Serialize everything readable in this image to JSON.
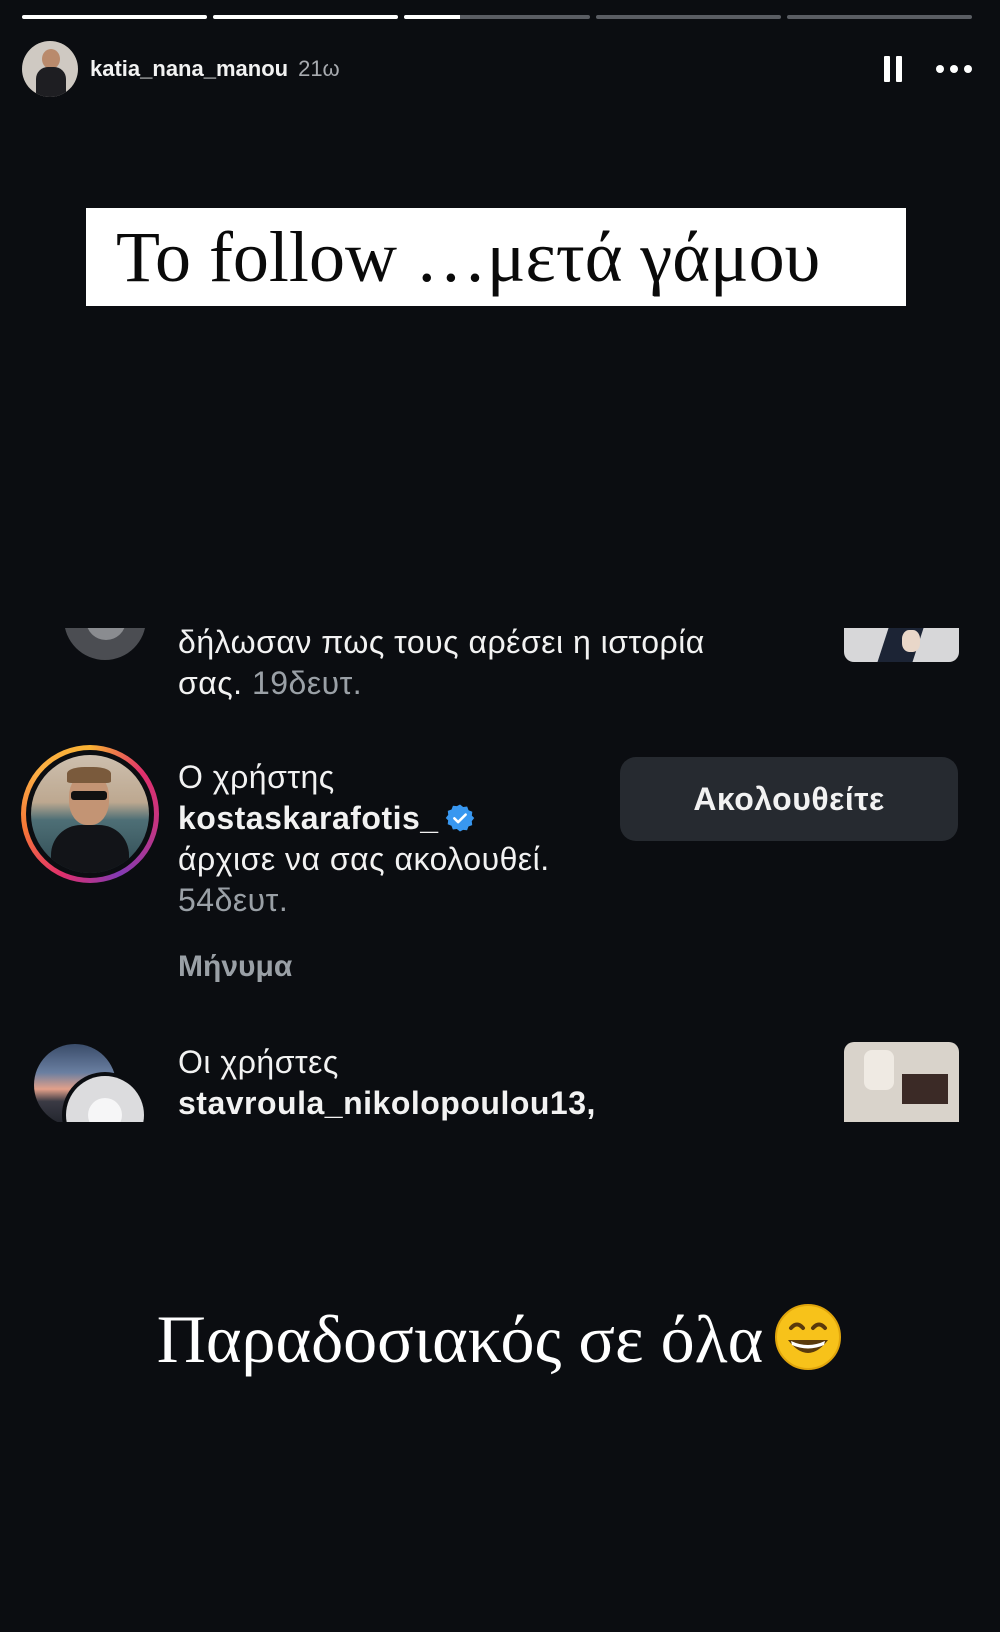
{
  "story": {
    "segments": [
      {
        "progress": 1
      },
      {
        "progress": 1
      },
      {
        "progress": 0.3
      },
      {
        "progress": 0
      },
      {
        "progress": 0
      }
    ]
  },
  "header": {
    "username": "katia_nana_manou",
    "time": "21ω",
    "pause_icon": "pause-icon",
    "more_icon": "more-horizontal-icon"
  },
  "title_text": "To follow …μετά γάμου",
  "notifications": {
    "first": {
      "text": "δήλωσαν πως τους αρέσει η ιστορία σας.",
      "time": "19δευτ."
    },
    "second": {
      "prefix": "Ο χρήστης",
      "username": "kostaskarafotis_",
      "verified_icon": "verified-badge-icon",
      "text": "άρχισε να σας ακολουθεί.",
      "time": "54δευτ.",
      "follow_button": "Ακολουθείτε",
      "message_link": "Μήνυμα"
    },
    "third": {
      "prefix": "Οι χρήστες",
      "username": "stavroula_nikolopoulou13,"
    }
  },
  "caption": "Παραδοσιακός σε όλα",
  "caption_emoji": "grinning-face-emoji",
  "colors": {
    "background": "#0b0d11",
    "verified_blue": "#3897f0",
    "button_bg": "#262a30",
    "muted_text": "#9aa0a6"
  }
}
